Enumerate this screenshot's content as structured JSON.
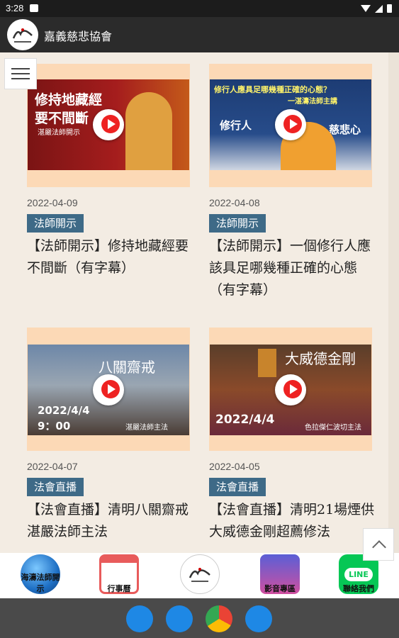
{
  "status_bar": {
    "time": "3:28"
  },
  "app": {
    "title": "嘉義慈悲協會"
  },
  "cards": [
    {
      "date": "2022-04-09",
      "badge": "法師開示",
      "title": "【法師開示】修持地藏經要不間斷（有字幕）",
      "thumb_text": [
        "修持地藏經",
        "要不間斷",
        "湛嚴法師開示"
      ]
    },
    {
      "date": "2022-04-08",
      "badge": "法師開示",
      "title": "【法師開示】一個修行人應該具足哪幾種正確的心態（有字幕）",
      "thumb_text": [
        "修行人應具足哪幾種正確的心態？",
        "一湛濤法師主講",
        "修行人",
        "慈悲心"
      ]
    },
    {
      "date": "2022-04-07",
      "badge": "法會直播",
      "title": "【法會直播】清明八關齋戒 湛嚴法師主法",
      "thumb_text": [
        "八關齋戒",
        "2022/4/4",
        "9：00",
        "湛嚴法師主法"
      ]
    },
    {
      "date": "2022-04-05",
      "badge": "法會直播",
      "title": "【法會直播】清明21場煙供 大威德金剛超薦修法",
      "thumb_text": [
        "大威德金剛",
        "2022/4/4",
        "色拉傑仁波切主法"
      ]
    }
  ],
  "bottom_nav": [
    {
      "label": "海濤法師開示",
      "icon": "wave-icon"
    },
    {
      "label": "行事曆",
      "icon": "calendar-icon"
    },
    {
      "label": "",
      "icon": "association-logo-icon"
    },
    {
      "label": "影音專區",
      "icon": "video-icon"
    },
    {
      "label": "聯絡我們",
      "icon": "line-icon",
      "icon_text": "LINE"
    }
  ],
  "colors": {
    "badge": "#3e6a87",
    "thumb_bg": "#fcd9b6",
    "app_bar": "#2b2b2b",
    "line_green": "#06c755"
  }
}
